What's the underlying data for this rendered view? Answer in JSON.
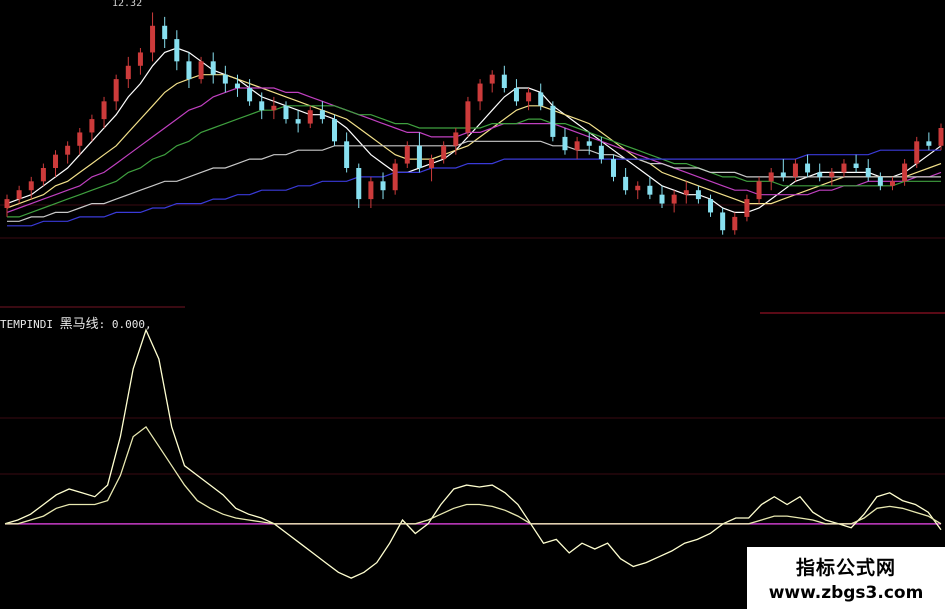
{
  "colors": {
    "background": "#000000",
    "up": "#cc3b3b",
    "down": "#88e0f0",
    "ma5": "#ffffff",
    "ma10": "#f2e08a",
    "ma20": "#c040c0",
    "ma30": "#3fa03f",
    "ma60": "#c8c8c8",
    "ma120": "#3a3ad8",
    "indicator_fast": "#ffffd0",
    "indicator_slow": "#e8e8b0",
    "zero_line": "#c83cc8",
    "grid": "#3a0a12"
  },
  "price_panel": {
    "high_marker": "12.32"
  },
  "indicator_panel": {
    "prefix": "TEMPINDI",
    "name": "黑马线",
    "value_text": ": 0.000,"
  },
  "watermark": {
    "title": "指标公式网",
    "url": "www.zbgs3.com"
  },
  "chart_data": [
    {
      "type": "candlestick",
      "ylim": [
        7.0,
        12.4
      ],
      "candles": [
        [
          7.9,
          8.2,
          7.7,
          8.1
        ],
        [
          8.1,
          8.4,
          8.0,
          8.3
        ],
        [
          8.3,
          8.6,
          8.1,
          8.5
        ],
        [
          8.5,
          8.9,
          8.4,
          8.8
        ],
        [
          8.8,
          9.2,
          8.6,
          9.1
        ],
        [
          9.1,
          9.4,
          8.9,
          9.3
        ],
        [
          9.3,
          9.7,
          9.1,
          9.6
        ],
        [
          9.6,
          10.0,
          9.4,
          9.9
        ],
        [
          9.9,
          10.4,
          9.7,
          10.3
        ],
        [
          10.3,
          10.9,
          10.1,
          10.8
        ],
        [
          10.8,
          11.3,
          10.6,
          11.1
        ],
        [
          11.1,
          11.5,
          10.9,
          11.4
        ],
        [
          11.4,
          12.3,
          11.2,
          12.0
        ],
        [
          12.0,
          12.2,
          11.5,
          11.7
        ],
        [
          11.7,
          11.9,
          11.0,
          11.2
        ],
        [
          11.2,
          11.4,
          10.6,
          10.8
        ],
        [
          10.8,
          11.3,
          10.7,
          11.2
        ],
        [
          11.2,
          11.4,
          10.7,
          10.9
        ],
        [
          10.9,
          11.1,
          10.5,
          10.7
        ],
        [
          10.7,
          10.9,
          10.4,
          10.6
        ],
        [
          10.6,
          10.8,
          10.2,
          10.3
        ],
        [
          10.3,
          10.5,
          9.9,
          10.1
        ],
        [
          10.1,
          10.4,
          9.9,
          10.2
        ],
        [
          10.2,
          10.3,
          9.8,
          9.9
        ],
        [
          9.9,
          10.1,
          9.6,
          9.8
        ],
        [
          9.8,
          10.2,
          9.7,
          10.1
        ],
        [
          10.1,
          10.3,
          9.8,
          9.9
        ],
        [
          9.9,
          10.0,
          9.3,
          9.4
        ],
        [
          9.4,
          9.6,
          8.7,
          8.8
        ],
        [
          8.8,
          8.9,
          7.9,
          8.1
        ],
        [
          8.1,
          8.6,
          7.9,
          8.5
        ],
        [
          8.5,
          8.7,
          8.1,
          8.3
        ],
        [
          8.3,
          9.0,
          8.2,
          8.9
        ],
        [
          8.9,
          9.4,
          8.8,
          9.3
        ],
        [
          9.3,
          9.6,
          8.7,
          8.8
        ],
        [
          8.8,
          9.1,
          8.5,
          9.0
        ],
        [
          9.0,
          9.4,
          8.9,
          9.3
        ],
        [
          9.3,
          9.7,
          9.1,
          9.6
        ],
        [
          9.6,
          10.4,
          9.5,
          10.3
        ],
        [
          10.3,
          10.8,
          10.1,
          10.7
        ],
        [
          10.7,
          11.0,
          10.5,
          10.9
        ],
        [
          10.9,
          11.1,
          10.5,
          10.6
        ],
        [
          10.6,
          10.8,
          10.2,
          10.3
        ],
        [
          10.3,
          10.6,
          10.1,
          10.5
        ],
        [
          10.5,
          10.7,
          10.1,
          10.2
        ],
        [
          10.2,
          10.3,
          9.4,
          9.5
        ],
        [
          9.5,
          9.7,
          9.1,
          9.2
        ],
        [
          9.2,
          9.5,
          9.0,
          9.4
        ],
        [
          9.4,
          9.6,
          9.1,
          9.3
        ],
        [
          9.3,
          9.5,
          8.9,
          9.0
        ],
        [
          9.0,
          9.1,
          8.5,
          8.6
        ],
        [
          8.6,
          8.8,
          8.2,
          8.3
        ],
        [
          8.3,
          8.5,
          8.1,
          8.4
        ],
        [
          8.4,
          8.6,
          8.1,
          8.2
        ],
        [
          8.2,
          8.4,
          7.9,
          8.0
        ],
        [
          8.0,
          8.3,
          7.8,
          8.2
        ],
        [
          8.2,
          8.5,
          8.0,
          8.3
        ],
        [
          8.3,
          8.4,
          8.0,
          8.1
        ],
        [
          8.1,
          8.2,
          7.7,
          7.8
        ],
        [
          7.8,
          7.9,
          7.3,
          7.4
        ],
        [
          7.4,
          7.8,
          7.3,
          7.7
        ],
        [
          7.7,
          8.2,
          7.6,
          8.1
        ],
        [
          8.1,
          8.6,
          8.0,
          8.5
        ],
        [
          8.5,
          8.8,
          8.3,
          8.7
        ],
        [
          8.7,
          9.0,
          8.5,
          8.6
        ],
        [
          8.6,
          9.0,
          8.5,
          8.9
        ],
        [
          8.9,
          9.1,
          8.6,
          8.7
        ],
        [
          8.7,
          8.9,
          8.5,
          8.6
        ],
        [
          8.6,
          8.8,
          8.4,
          8.7
        ],
        [
          8.7,
          9.0,
          8.6,
          8.9
        ],
        [
          8.9,
          9.1,
          8.7,
          8.8
        ],
        [
          8.8,
          9.0,
          8.5,
          8.6
        ],
        [
          8.6,
          8.7,
          8.3,
          8.4
        ],
        [
          8.4,
          8.6,
          8.3,
          8.5
        ],
        [
          8.5,
          9.0,
          8.4,
          8.9
        ],
        [
          8.9,
          9.5,
          8.8,
          9.4
        ],
        [
          9.4,
          9.6,
          9.2,
          9.3
        ],
        [
          9.3,
          9.8,
          9.2,
          9.7
        ]
      ],
      "moving_averages": [
        {
          "key": "ma5",
          "values": [
            8.0,
            8.1,
            8.2,
            8.4,
            8.6,
            8.8,
            9.1,
            9.4,
            9.7,
            10.0,
            10.4,
            10.7,
            11.1,
            11.4,
            11.5,
            11.4,
            11.2,
            11.0,
            10.9,
            10.8,
            10.6,
            10.4,
            10.3,
            10.2,
            10.1,
            10.0,
            10.0,
            9.9,
            9.7,
            9.4,
            9.1,
            8.9,
            8.7,
            8.7,
            8.8,
            8.9,
            9.0,
            9.2,
            9.5,
            9.8,
            10.1,
            10.4,
            10.6,
            10.6,
            10.5,
            10.2,
            10.0,
            9.8,
            9.6,
            9.4,
            9.2,
            9.0,
            8.8,
            8.6,
            8.4,
            8.3,
            8.2,
            8.2,
            8.1,
            7.9,
            7.8,
            7.8,
            7.9,
            8.1,
            8.3,
            8.5,
            8.6,
            8.7,
            8.7,
            8.7,
            8.7,
            8.7,
            8.6,
            8.6,
            8.7,
            8.9,
            9.1,
            9.3
          ]
        },
        {
          "key": "ma10",
          "values": [
            7.9,
            8.0,
            8.1,
            8.2,
            8.4,
            8.5,
            8.7,
            8.9,
            9.1,
            9.3,
            9.6,
            9.9,
            10.2,
            10.5,
            10.7,
            10.8,
            10.9,
            10.9,
            10.9,
            10.8,
            10.7,
            10.6,
            10.5,
            10.4,
            10.3,
            10.2,
            10.1,
            10.0,
            9.9,
            9.7,
            9.5,
            9.3,
            9.1,
            9.0,
            9.0,
            9.0,
            9.1,
            9.2,
            9.3,
            9.5,
            9.7,
            9.9,
            10.1,
            10.2,
            10.2,
            10.1,
            10.0,
            9.9,
            9.8,
            9.6,
            9.4,
            9.2,
            9.0,
            8.9,
            8.7,
            8.6,
            8.5,
            8.4,
            8.3,
            8.2,
            8.1,
            8.0,
            8.0,
            8.0,
            8.1,
            8.2,
            8.3,
            8.4,
            8.5,
            8.6,
            8.6,
            8.6,
            8.6,
            8.6,
            8.6,
            8.7,
            8.8,
            8.9
          ]
        },
        {
          "key": "ma20",
          "values": [
            7.8,
            7.9,
            8.0,
            8.1,
            8.2,
            8.3,
            8.4,
            8.6,
            8.7,
            8.9,
            9.1,
            9.3,
            9.5,
            9.7,
            9.9,
            10.1,
            10.2,
            10.4,
            10.5,
            10.6,
            10.6,
            10.6,
            10.6,
            10.5,
            10.5,
            10.4,
            10.3,
            10.2,
            10.1,
            10.0,
            9.9,
            9.8,
            9.7,
            9.6,
            9.6,
            9.5,
            9.5,
            9.5,
            9.6,
            9.6,
            9.7,
            9.8,
            9.8,
            9.8,
            9.8,
            9.8,
            9.7,
            9.6,
            9.5,
            9.4,
            9.3,
            9.2,
            9.1,
            9.0,
            8.9,
            8.8,
            8.7,
            8.6,
            8.5,
            8.4,
            8.3,
            8.3,
            8.2,
            8.2,
            8.2,
            8.2,
            8.2,
            8.3,
            8.3,
            8.4,
            8.4,
            8.5,
            8.5,
            8.5,
            8.5,
            8.6,
            8.6,
            8.7
          ]
        },
        {
          "key": "ma30",
          "values": [
            7.7,
            7.7,
            7.8,
            7.9,
            8.0,
            8.1,
            8.2,
            8.3,
            8.4,
            8.5,
            8.7,
            8.8,
            9.0,
            9.1,
            9.3,
            9.4,
            9.6,
            9.7,
            9.8,
            9.9,
            10.0,
            10.1,
            10.1,
            10.2,
            10.2,
            10.2,
            10.2,
            10.2,
            10.1,
            10.0,
            10.0,
            9.9,
            9.8,
            9.8,
            9.7,
            9.7,
            9.7,
            9.7,
            9.7,
            9.7,
            9.8,
            9.8,
            9.8,
            9.9,
            9.9,
            9.8,
            9.8,
            9.7,
            9.6,
            9.5,
            9.4,
            9.3,
            9.2,
            9.1,
            9.0,
            8.9,
            8.9,
            8.8,
            8.7,
            8.6,
            8.6,
            8.5,
            8.5,
            8.5,
            8.4,
            8.4,
            8.4,
            8.4,
            8.4,
            8.4,
            8.4,
            8.4,
            8.4,
            8.4,
            8.5,
            8.5,
            8.5,
            8.5
          ]
        },
        {
          "key": "ma60",
          "values": [
            7.6,
            7.6,
            7.7,
            7.7,
            7.8,
            7.8,
            7.9,
            8.0,
            8.0,
            8.1,
            8.2,
            8.3,
            8.4,
            8.5,
            8.5,
            8.6,
            8.7,
            8.8,
            8.8,
            8.9,
            9.0,
            9.0,
            9.1,
            9.1,
            9.2,
            9.2,
            9.2,
            9.3,
            9.3,
            9.3,
            9.3,
            9.3,
            9.3,
            9.3,
            9.3,
            9.3,
            9.3,
            9.3,
            9.4,
            9.4,
            9.4,
            9.4,
            9.4,
            9.4,
            9.4,
            9.3,
            9.3,
            9.2,
            9.2,
            9.1,
            9.1,
            9.0,
            9.0,
            8.9,
            8.9,
            8.8,
            8.8,
            8.8,
            8.7,
            8.7,
            8.7,
            8.6,
            8.6,
            8.6,
            8.6,
            8.6,
            8.6,
            8.6,
            8.6,
            8.6,
            8.6,
            8.6,
            8.6,
            8.6,
            8.6,
            8.6,
            8.6,
            8.6
          ]
        },
        {
          "key": "ma120",
          "values": [
            7.5,
            7.5,
            7.5,
            7.6,
            7.6,
            7.6,
            7.7,
            7.7,
            7.7,
            7.8,
            7.8,
            7.8,
            7.9,
            7.9,
            8.0,
            8.0,
            8.0,
            8.1,
            8.1,
            8.2,
            8.2,
            8.3,
            8.3,
            8.3,
            8.4,
            8.4,
            8.5,
            8.5,
            8.5,
            8.6,
            8.6,
            8.6,
            8.7,
            8.7,
            8.7,
            8.8,
            8.8,
            8.8,
            8.9,
            8.9,
            8.9,
            9.0,
            9.0,
            9.0,
            9.0,
            9.0,
            9.0,
            9.0,
            9.0,
            9.0,
            9.0,
            9.0,
            9.0,
            9.0,
            9.0,
            9.0,
            9.0,
            9.0,
            9.0,
            9.0,
            9.0,
            9.0,
            9.0,
            9.0,
            9.0,
            9.0,
            9.1,
            9.1,
            9.1,
            9.1,
            9.1,
            9.1,
            9.2,
            9.2,
            9.2,
            9.2,
            9.2,
            9.2
          ]
        }
      ]
    },
    {
      "type": "line",
      "ylim": [
        -0.3,
        1.0
      ],
      "baseline": 0.0,
      "series": [
        {
          "key": "fast",
          "values": [
            0.0,
            0.02,
            0.05,
            0.1,
            0.15,
            0.18,
            0.16,
            0.14,
            0.2,
            0.45,
            0.8,
            1.0,
            0.85,
            0.5,
            0.3,
            0.25,
            0.2,
            0.15,
            0.08,
            0.05,
            0.03,
            0.0,
            -0.05,
            -0.1,
            -0.15,
            -0.2,
            -0.25,
            -0.28,
            -0.25,
            -0.2,
            -0.1,
            0.02,
            -0.05,
            0.0,
            0.1,
            0.18,
            0.2,
            0.19,
            0.2,
            0.16,
            0.1,
            0.0,
            -0.1,
            -0.08,
            -0.15,
            -0.1,
            -0.13,
            -0.1,
            -0.18,
            -0.22,
            -0.2,
            -0.17,
            -0.14,
            -0.1,
            -0.08,
            -0.05,
            0.0,
            0.03,
            0.03,
            0.1,
            0.14,
            0.1,
            0.14,
            0.06,
            0.02,
            0.0,
            -0.02,
            0.05,
            0.14,
            0.16,
            0.12,
            0.1,
            0.06,
            -0.03
          ]
        },
        {
          "key": "slow",
          "values": [
            0.0,
            0.0,
            0.02,
            0.04,
            0.08,
            0.1,
            0.1,
            0.1,
            0.12,
            0.25,
            0.45,
            0.5,
            0.4,
            0.3,
            0.2,
            0.12,
            0.08,
            0.05,
            0.03,
            0.02,
            0.01,
            0.0,
            0.0,
            0.0,
            0.0,
            0.0,
            0.0,
            0.0,
            0.0,
            0.0,
            0.0,
            0.0,
            0.0,
            0.02,
            0.05,
            0.08,
            0.1,
            0.1,
            0.09,
            0.07,
            0.04,
            0.0,
            0.0,
            0.0,
            0.0,
            0.0,
            0.0,
            0.0,
            0.0,
            0.0,
            0.0,
            0.0,
            0.0,
            0.0,
            0.0,
            0.0,
            0.0,
            0.0,
            0.0,
            0.02,
            0.04,
            0.04,
            0.03,
            0.02,
            0.0,
            0.0,
            0.0,
            0.03,
            0.08,
            0.09,
            0.08,
            0.06,
            0.04,
            0.0
          ]
        }
      ]
    }
  ]
}
